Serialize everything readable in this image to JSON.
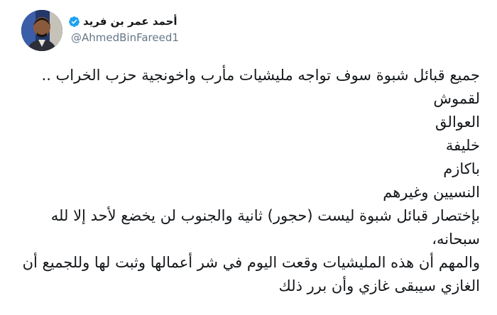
{
  "author": {
    "display_name": "أحمد عمر بن فريد",
    "handle": "@AhmedBinFareed1",
    "verified": true,
    "verified_color": "#1da1f2"
  },
  "tweet": {
    "lines": [
      "جميع قبائل شبوة سوف تواجه مليشيات مأرب واخونجية حزب الخراب ..",
      "لقموش",
      "العوالق",
      "خليفة",
      "باكازم",
      "النسيين وغيرهم",
      "بإختصار قبائل شبوة ليست (حجور) ثانية والجنوب لن يخضع لأحد إلا لله",
      "سبحانه،",
      "والمهم أن هذه المليشيات وقعت اليوم في شر أعمالها وثبت لها وللجميع أن",
      "الغازي سيبقى غازي وأن برر ذلك"
    ]
  },
  "icons": {
    "avatar": "profile-photo",
    "verified": "verified-badge-icon"
  }
}
